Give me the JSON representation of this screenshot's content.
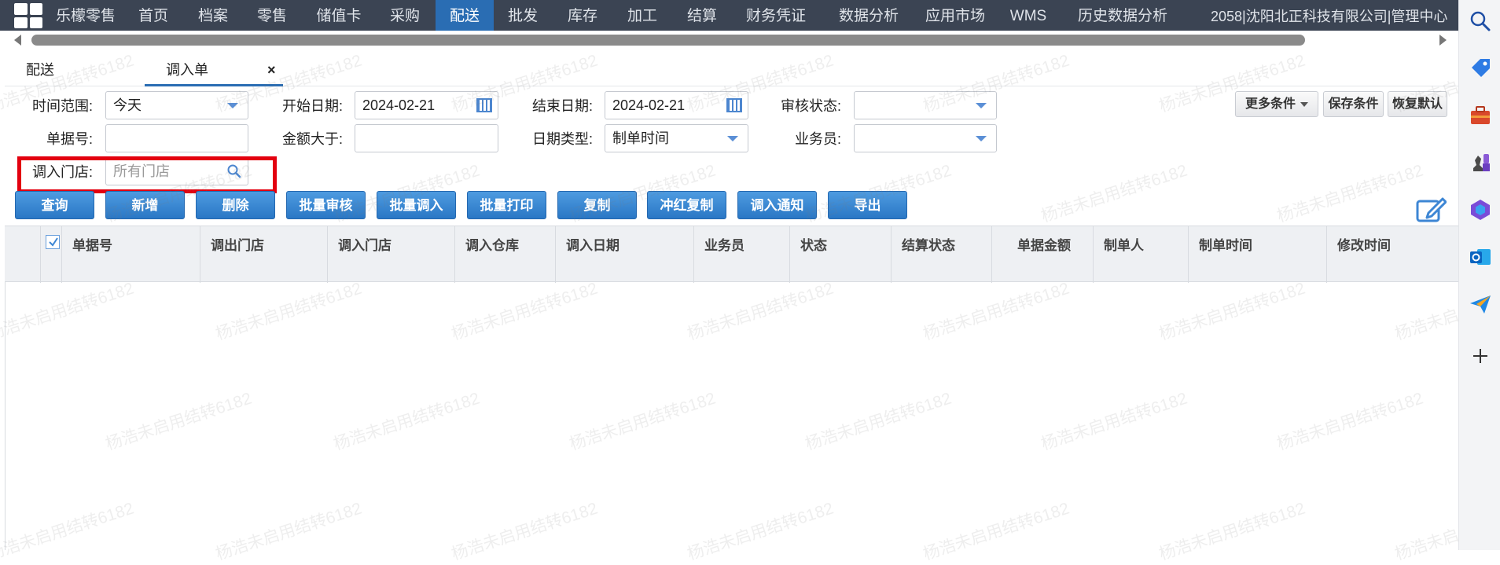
{
  "nav": {
    "items": [
      "乐檬零售",
      "首页",
      "档案",
      "零售",
      "储值卡",
      "采购",
      "配送",
      "批发",
      "库存",
      "加工",
      "结算",
      "财务凭证",
      "数据分析",
      "应用市场",
      "WMS",
      "历史数据分析"
    ],
    "active_index": 6,
    "company": "2058|沈阳北正科技有限公司|管理中心"
  },
  "tabs": {
    "first": "配送",
    "active": "调入单",
    "close": "×"
  },
  "filters": {
    "time_range": {
      "label": "时间范围:",
      "value": "今天"
    },
    "start_date": {
      "label": "开始日期:",
      "value": "2024-02-21"
    },
    "end_date": {
      "label": "结束日期:",
      "value": "2024-02-21"
    },
    "audit_status": {
      "label": "审核状态:",
      "value": ""
    },
    "doc_no": {
      "label": "单据号:",
      "value": ""
    },
    "amount_gt": {
      "label": "金额大于:",
      "value": ""
    },
    "date_type": {
      "label": "日期类型:",
      "value": "制单时间"
    },
    "salesperson": {
      "label": "业务员:",
      "value": ""
    },
    "in_store": {
      "label": "调入门店:",
      "placeholder": "所有门店"
    }
  },
  "condition_buttons": {
    "more": "更多条件",
    "save": "保存条件",
    "reset": "恢复默认"
  },
  "actions": [
    "查询",
    "新增",
    "删除",
    "批量审核",
    "批量调入",
    "批量打印",
    "复制",
    "冲红复制",
    "调入通知",
    "导出"
  ],
  "table": {
    "columns": [
      "单据号",
      "调出门店",
      "调入门店",
      "调入仓库",
      "调入日期",
      "业务员",
      "状态",
      "结算状态",
      "单据金额",
      "制单人",
      "制单时间",
      "修改时间"
    ]
  },
  "watermark": "杨浩未启用结转6182",
  "colors": {
    "nav_bg": "#3b4453",
    "nav_active": "#2a6db3",
    "button_blue": "#2f7dcb",
    "highlight": "#e3000f"
  }
}
